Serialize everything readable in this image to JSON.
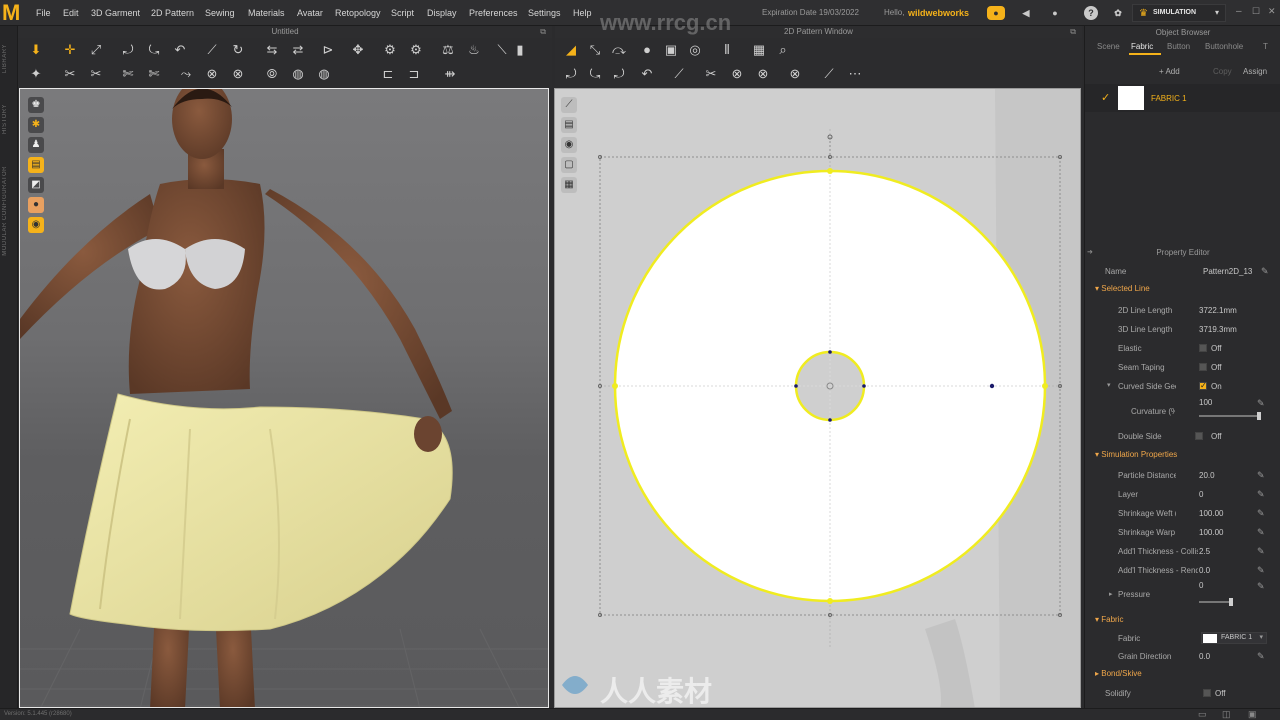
{
  "app": {
    "logo": "M",
    "expiration": "Expiration Date 19/03/2022",
    "hello": "Hello,",
    "user": "wildwebworks",
    "mode": "SIMULATION"
  },
  "menu": [
    "File",
    "Edit",
    "3D Garment",
    "2D Pattern",
    "Sewing",
    "Materials",
    "Avatar",
    "Retopology",
    "Script",
    "Display",
    "Preferences",
    "Settings",
    "Help"
  ],
  "left_strip": [
    "LIBRARY",
    "HISTORY",
    "MODULAR CONFIGURATOR"
  ],
  "view3d": {
    "title": "Untitled"
  },
  "view2d": {
    "title": "2D Pattern Window"
  },
  "object_browser": {
    "title": "Object Browser",
    "tabs": [
      "Scene",
      "Fabric",
      "Button",
      "Buttonhole",
      "T"
    ],
    "active_tab": "Fabric",
    "actions": {
      "add": "+ Add",
      "copy": "Copy",
      "assign": "Assign"
    },
    "item": "FABRIC 1"
  },
  "property_editor": {
    "title": "Property Editor",
    "name_label": "Name",
    "name_value": "Pattern2D_13",
    "selected_line": {
      "section": "Selected Line",
      "len2d_label": "2D Line Length",
      "len2d": "3722.1mm",
      "len3d_label": "3D Line Length",
      "len3d": "3719.3mm",
      "elastic_label": "Elastic",
      "elastic": "Off",
      "seam_label": "Seam Taping",
      "seam": "Off",
      "curved_label": "Curved Side Geometry",
      "curved": "On",
      "curvature_label": "Curvature (%)",
      "curvature": "100",
      "double_label": "Double Side",
      "double": "Off"
    },
    "simulation": {
      "section": "Simulation Properties",
      "particle_label": "Particle Distance (mm)",
      "particle": "20.0",
      "layer_label": "Layer",
      "layer": "0",
      "weft_label": "Shrinkage Weft (%)",
      "weft": "100.00",
      "warp_label": "Shrinkage Warp (%)",
      "warp": "100.00",
      "coll_label": "Add'l Thickness - Collision",
      "coll": "2.5",
      "rend_label": "Add'l Thickness - Rendering",
      "rend": "0.0",
      "pressure_label": "Pressure",
      "pressure": "0"
    },
    "fabric": {
      "section": "Fabric",
      "fabric_label": "Fabric",
      "fabric": "FABRIC 1",
      "grain_label": "Grain Direction",
      "grain": "0.0"
    },
    "bond": {
      "section": "Bond/Skive"
    },
    "solidify_label": "Solidify",
    "solidify": "Off"
  },
  "status": {
    "version": "Version: 5.1.445 (r28680)"
  },
  "watermark": {
    "url": "www.rrcg.cn",
    "brand": "RRCG",
    "cn": "人人素材"
  }
}
